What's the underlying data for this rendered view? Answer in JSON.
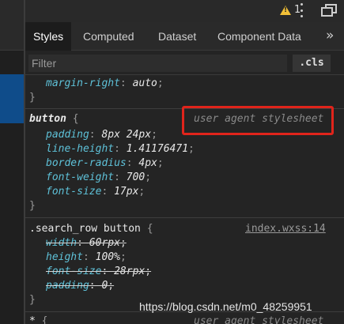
{
  "toolbar": {
    "warning_count": "1",
    "warning_icon": "warning-triangle-icon",
    "more_icon": "kebab-menu-icon",
    "dock_icon": "undock-icon"
  },
  "tabs": [
    {
      "label": "Styles",
      "active": true
    },
    {
      "label": "Computed"
    },
    {
      "label": "Dataset"
    },
    {
      "label": "Component Data"
    }
  ],
  "tabs_overflow": "»",
  "filter": {
    "placeholder": "Filter",
    "value": "",
    "cls_label": ".cls"
  },
  "rules": {
    "r0": {
      "prop": "margin-right",
      "value": "auto"
    },
    "r1": {
      "selector": "button",
      "origin": "user agent stylesheet",
      "props": [
        {
          "name": "padding",
          "value": "8px 24px"
        },
        {
          "name": "line-height",
          "value": "1.41176471"
        },
        {
          "name": "border-radius",
          "value": "4px"
        },
        {
          "name": "font-weight",
          "value": "700"
        },
        {
          "name": "font-size",
          "value": "17px"
        }
      ]
    },
    "r2": {
      "selector": ".search_row button",
      "source": "index.wxss:14",
      "props": [
        {
          "name": "width",
          "value": "60rpx",
          "overridden": true
        },
        {
          "name": "height",
          "value": "100%",
          "overridden": false
        },
        {
          "name": "font-size",
          "value": "28rpx",
          "overridden": true
        },
        {
          "name": "padding",
          "value": "0",
          "overridden": true
        }
      ]
    },
    "r3": {
      "selector": "*",
      "origin": "user agent stylesheet"
    }
  },
  "punct": {
    "open": "{",
    "close": "}",
    "colon": ": ",
    "semi": ";"
  },
  "watermark": "https://blog.csdn.net/m0_48259951",
  "colors": {
    "highlight_box": "#e0241b",
    "property_name": "#5ec1d8",
    "selected_node": "#0f4c8a"
  }
}
